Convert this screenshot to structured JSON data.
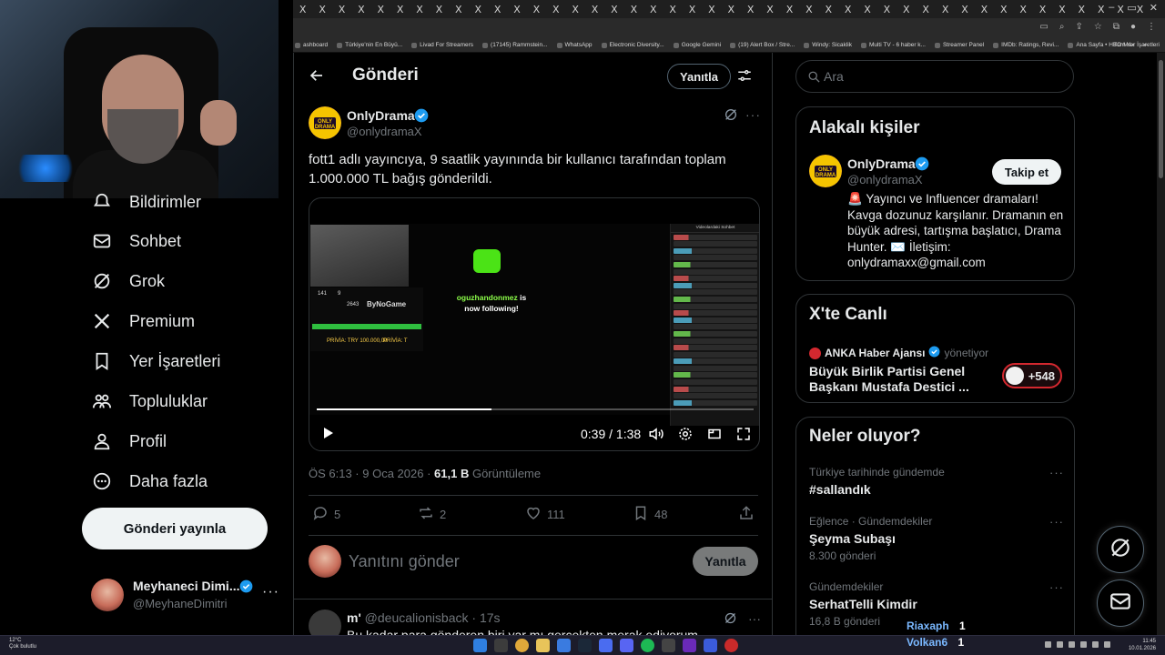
{
  "browser": {
    "tab_glyph": "X",
    "tab_count": 44,
    "bookmarks": [
      "ashboard",
      "Türkiye'nin En Büyü...",
      "Livad For Streamers",
      "(17145) Rammstein...",
      "WhatsApp",
      "Electronic Diversity...",
      "Google Gemini",
      "(19) Alert Box / Stre...",
      "Windy: Sicaklik",
      "Multi TV - 6 haber k...",
      "Streamer Panel",
      "IMDb: Ratings, Revi...",
      "Ana Sayfa • HBO Max"
    ],
    "bookmarks_more": "»",
    "all_bookmarks": "Tüm Yer İşaretleri"
  },
  "nav": {
    "items": [
      {
        "label": "Bildirimler",
        "icon": "bell-icon"
      },
      {
        "label": "Sohbet",
        "icon": "envelope-icon"
      },
      {
        "label": "Grok",
        "icon": "grok-icon"
      },
      {
        "label": "Premium",
        "icon": "x-logo-icon"
      },
      {
        "label": "Yer İşaretleri",
        "icon": "bookmark-icon"
      },
      {
        "label": "Topluluklar",
        "icon": "communities-icon"
      },
      {
        "label": "Profil",
        "icon": "person-icon"
      },
      {
        "label": "Daha fazla",
        "icon": "more-circle-icon"
      }
    ],
    "post_button": "Gönderi yayınla"
  },
  "account": {
    "name": "Meyhaneci Dimi...",
    "handle": "@MeyhaneDimitri",
    "more": "···"
  },
  "main": {
    "header_title": "Gönderi",
    "reply_header_button": "Yanıtla",
    "post": {
      "author_name": "OnlyDrama",
      "author_handle": "@onlydramaX",
      "text": "fott1 adlı yayıncıya, 9 saatlik yayınında bir kullanıcı tarafından toplam 1.000.000 TL bağış gönderildi.",
      "video": {
        "current_time": "0:39",
        "duration": "1:38",
        "progress": 0.4,
        "time_display": "0:39 / 1:38",
        "chat_title": "Videolardaki Sohbet",
        "follow_user": "oguzhandonmez",
        "follow_suffix": "is",
        "follow_line2": "now following!",
        "overlay_brand": "ByNoGame",
        "stat_1": "141",
        "stat_2": "9",
        "stat_3": "2643",
        "stat_4": "PRİVİA: TRY 100.000,00",
        "stat_5": "PRİVİA: T"
      },
      "timestamp": "ÖS 6:13 · 9 Oca 2026 · ",
      "views_count": "61,1 B",
      "views_label": " Görüntüleme",
      "replies": "5",
      "reposts": "2",
      "likes": "111",
      "bookmarks": "48"
    },
    "reply_box": {
      "placeholder": "Yanıtını gönder",
      "button": "Yanıtla"
    },
    "comment": {
      "name": "m'",
      "handle": "@deucalionisback",
      "time": "· 17s",
      "text": "Bu kadar para gönderen biri var mı gerçekten merak ediyorum"
    }
  },
  "right": {
    "search_placeholder": "Ara",
    "related": {
      "title": "Alakalı kişiler",
      "name": "OnlyDrama",
      "handle": "@onlydramaX",
      "follow_button": "Takip et",
      "bio": "🚨 Yayıncı ve Influencer dramaları! Kavga dozunuz karşılanır. Dramanın en büyük adresi, tartışma başlatıcı, Drama Hunter. ✉️ İletişim: onlydramaxx@gmail.com"
    },
    "live": {
      "title": "X'te Canlı",
      "host": "ANKA Haber Ajansı",
      "host_suffix": "yönetiyor",
      "stream_title": "Büyük Birlik Partisi Genel Başkanı Mustafa Destici ...",
      "listeners": "+548"
    },
    "trends": {
      "title": "Neler oluyor?",
      "items": [
        {
          "category": "Türkiye tarihinde gündemde",
          "name": "#sallandık",
          "count": ""
        },
        {
          "category": "Eğlence · Gündemdekiler",
          "name": "Şeyma Subaşı",
          "count": "8.300 gönderi"
        },
        {
          "category": "Gündemdekiler",
          "name": "SerhatTelli Kimdir",
          "count": "16,8 B gönderi"
        }
      ]
    }
  },
  "overlay_names": [
    {
      "name": "Riaxaph",
      "count": "1"
    },
    {
      "name": "Volkan6",
      "count": "1"
    }
  ],
  "taskbar": {
    "weather_temp": "12°C",
    "weather_desc": "Çok bulutlu",
    "time": "11:45",
    "date": "10.01.2026"
  },
  "colors": {
    "accent_blue": "#1d9bf0",
    "verified": "#1d9bf0",
    "live_red": "#d4282f",
    "overlay_purple": "#6a5cff"
  }
}
